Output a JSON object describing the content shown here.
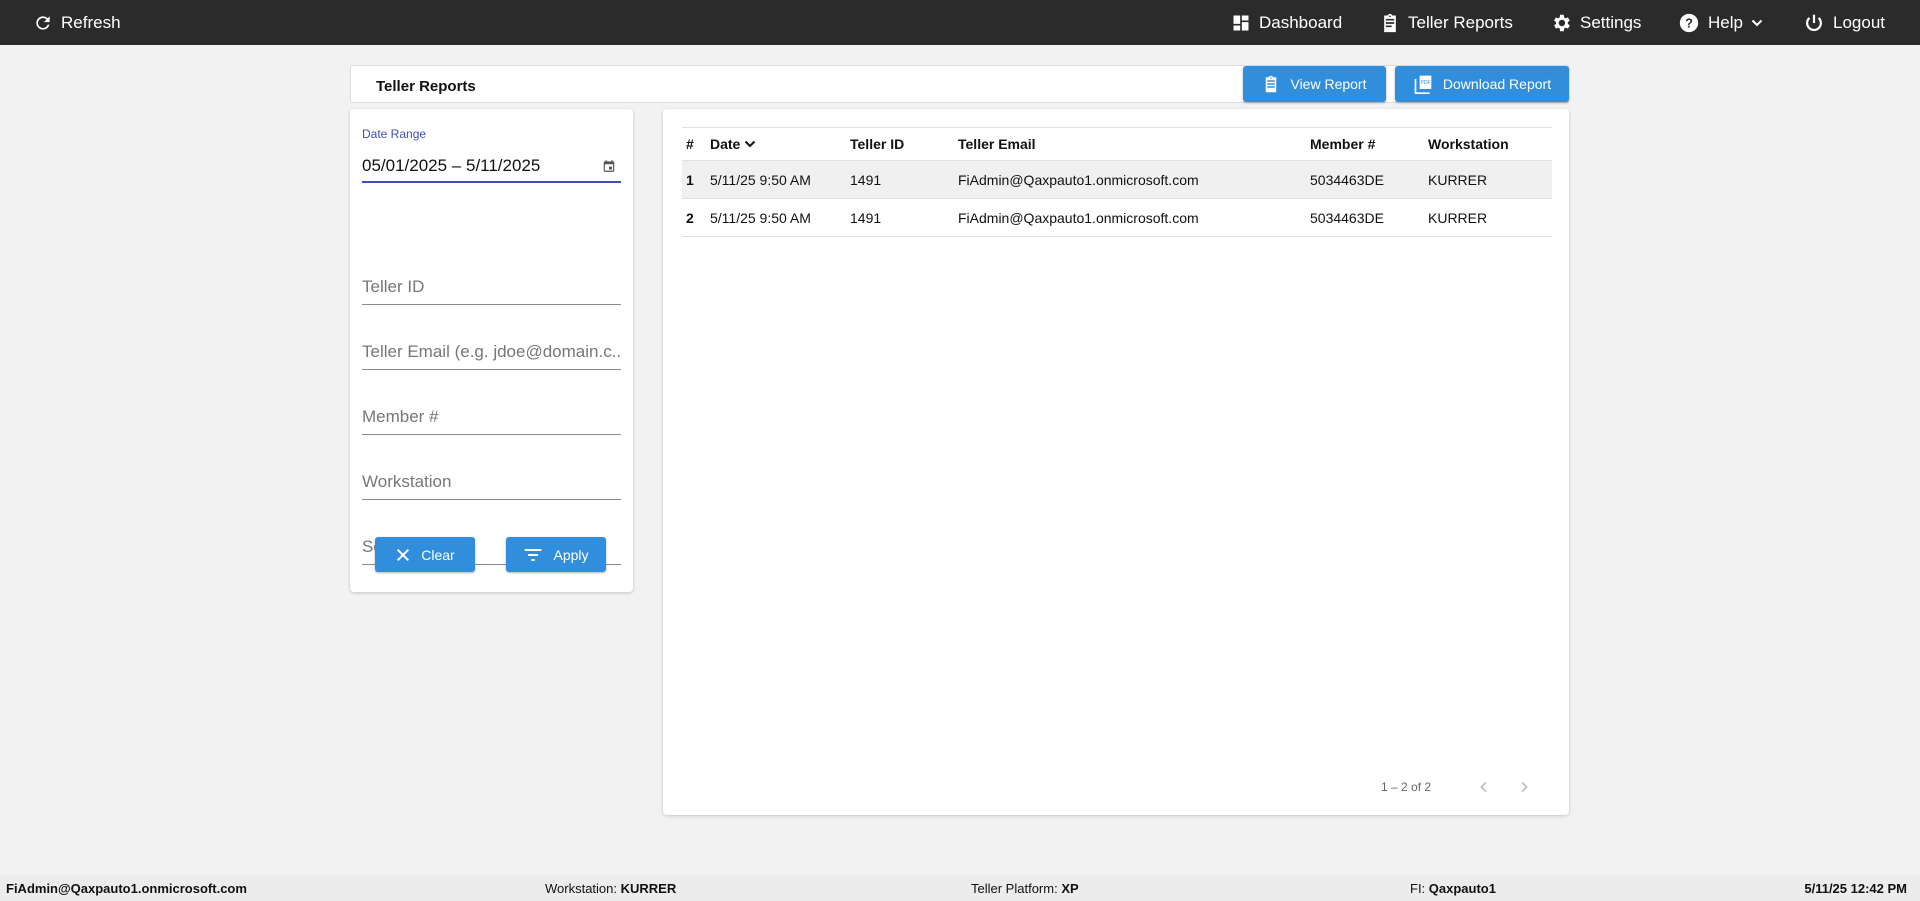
{
  "topbar": {
    "refresh": "Refresh",
    "nav": [
      {
        "label": "Dashboard",
        "icon": "dashboard-icon"
      },
      {
        "label": "Teller Reports",
        "icon": "clipboard-icon"
      },
      {
        "label": "Settings",
        "icon": "gear-icon"
      },
      {
        "label": "Help",
        "icon": "help-icon"
      },
      {
        "label": "Logout",
        "icon": "power-icon"
      }
    ]
  },
  "header": {
    "title": "Teller Reports",
    "view_report": "View Report",
    "download_report": "Download Report"
  },
  "filters": {
    "date_range_label": "Date Range",
    "date_range_value": "05/01/2025 – 5/11/2025",
    "teller_id": "Teller ID",
    "teller_email": "Teller Email (e.g. jdoe@domain.c...",
    "member": "Member #",
    "workstation": "Workstation",
    "search_text": "Search Text",
    "clear": "Clear",
    "apply": "Apply"
  },
  "table": {
    "columns": [
      "#",
      "Date",
      "Teller ID",
      "Teller Email",
      "Member #",
      "Workstation"
    ],
    "rows": [
      [
        "1",
        "5/11/25 9:50 AM",
        "1491",
        "FiAdmin@Qaxpauto1.onmicrosoft.com",
        "5034463DE",
        "KURRER"
      ],
      [
        "2",
        "5/11/25 9:50 AM",
        "1491",
        "FiAdmin@Qaxpauto1.onmicrosoft.com",
        "5034463DE",
        "KURRER"
      ]
    ],
    "pagination": "1 – 2 of 2"
  },
  "footer": {
    "user": "FiAdmin@Qaxpauto1.onmicrosoft.com",
    "workstation_label": "Workstation: ",
    "workstation": "KURRER",
    "platform_label": "Teller Platform: ",
    "platform": "XP",
    "fi_label": "FI: ",
    "fi": "Qaxpauto1",
    "datetime": "5/11/25 12:42 PM"
  },
  "colors": {
    "accent": "#318edc",
    "topbar": "#2b2b2b",
    "focus": "#3f51b5"
  }
}
